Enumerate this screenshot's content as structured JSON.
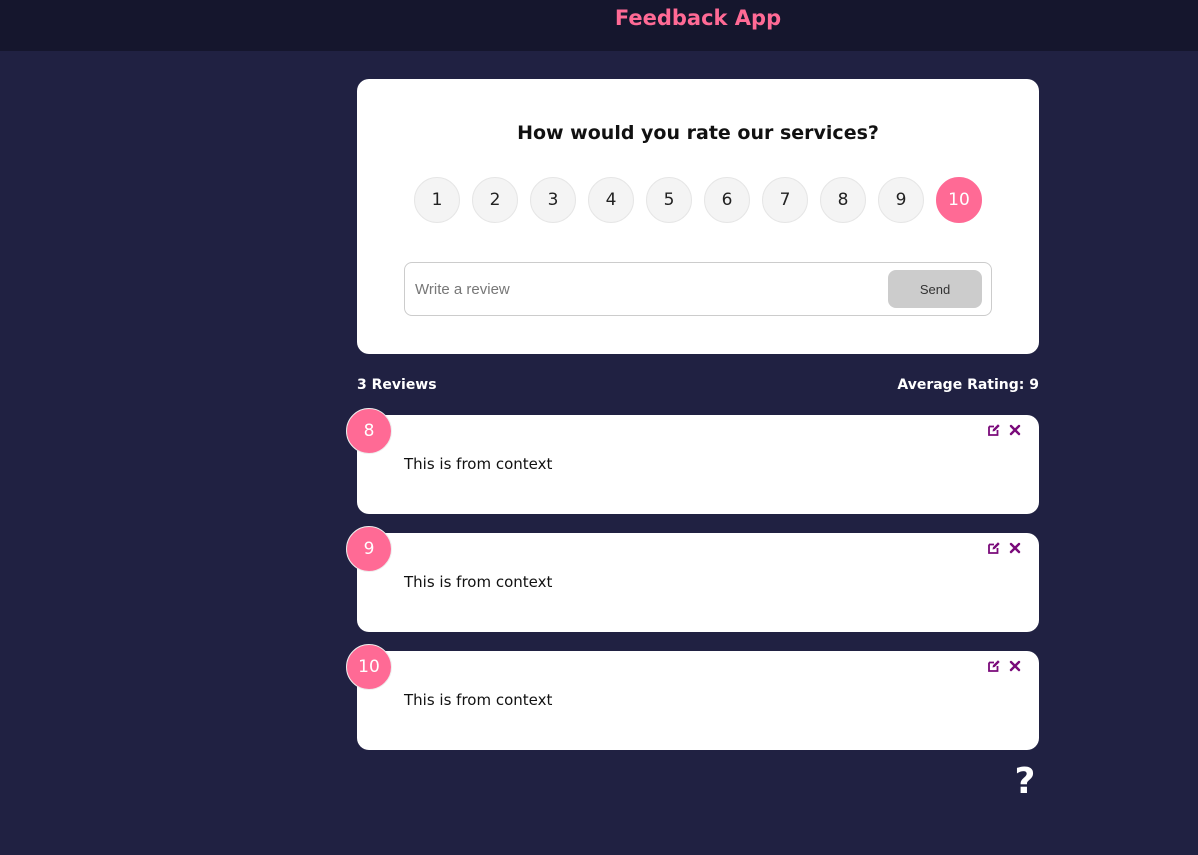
{
  "app": {
    "title": "Feedback App"
  },
  "colors": {
    "accent": "#ff6a95",
    "background": "#202142",
    "header": "#15162d",
    "action_icon": "#7a0a7a"
  },
  "rating_form": {
    "question": "How would you rate our services?",
    "options": [
      "1",
      "2",
      "3",
      "4",
      "5",
      "6",
      "7",
      "8",
      "9",
      "10"
    ],
    "selected": "10",
    "review_placeholder": "Write a review",
    "review_value": "",
    "send_label": "Send"
  },
  "stats": {
    "count_label": "3 Reviews",
    "average_label": "Average Rating: 9"
  },
  "feedback": [
    {
      "rating": "8",
      "text": "This is from context"
    },
    {
      "rating": "9",
      "text": "This is from context"
    },
    {
      "rating": "10",
      "text": "This is from context"
    }
  ],
  "icons": {
    "edit": "edit-icon",
    "delete": "close-icon",
    "help": "question-icon"
  },
  "help": {
    "label": "?"
  }
}
